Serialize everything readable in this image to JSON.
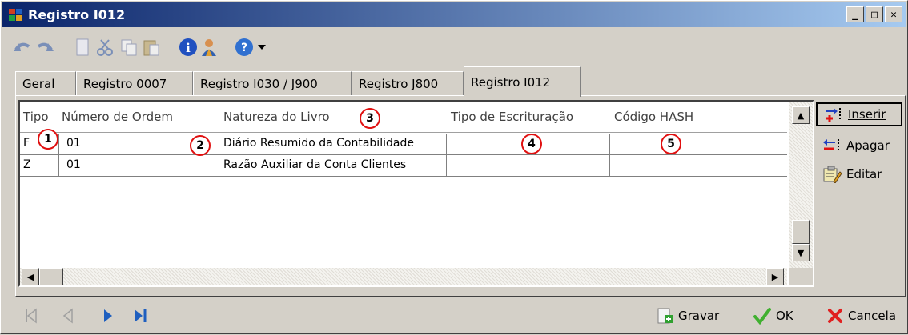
{
  "window": {
    "title": "Registro I012",
    "controls": [
      "minimize",
      "maximize",
      "close"
    ]
  },
  "toolbar": {
    "icons": [
      "undo-icon",
      "redo-icon",
      "new-icon",
      "cut-icon",
      "copy-icon",
      "paste-icon",
      "info-icon",
      "user-icon",
      "help-icon",
      "dropdown-arrow-icon"
    ]
  },
  "tabs": [
    {
      "label": "Geral",
      "active": false
    },
    {
      "label": "Registro 0007",
      "active": false
    },
    {
      "label": "Registro I030 / J900",
      "active": false
    },
    {
      "label": "Registro J800",
      "active": false
    },
    {
      "label": "Registro I012",
      "active": true
    }
  ],
  "grid": {
    "columns": [
      "Tipo",
      "Número de Ordem",
      "Natureza do Livro",
      "Tipo de Escrituração",
      "Código HASH"
    ],
    "rows": [
      {
        "tipo": "F",
        "numero": "01",
        "natureza": "Diário Resumido da Contabilidade",
        "escrituracao": "",
        "hash": ""
      },
      {
        "tipo": "Z",
        "numero": "01",
        "natureza": "Razão Auxiliar da Conta Clientes",
        "escrituracao": "",
        "hash": ""
      }
    ]
  },
  "annotations": [
    "1",
    "2",
    "3",
    "4",
    "5"
  ],
  "side_buttons": {
    "inserir": "Inserir",
    "apagar": "Apagar",
    "editar": "Editar"
  },
  "bottom": {
    "gravar": "Gravar",
    "ok": "OK",
    "cancela": "Cancela"
  },
  "colors": {
    "titlebar_start": "#0a246a",
    "titlebar_end": "#a6caf0",
    "annotation_red": "#e01010",
    "nav_blue": "#1f5fbf"
  }
}
